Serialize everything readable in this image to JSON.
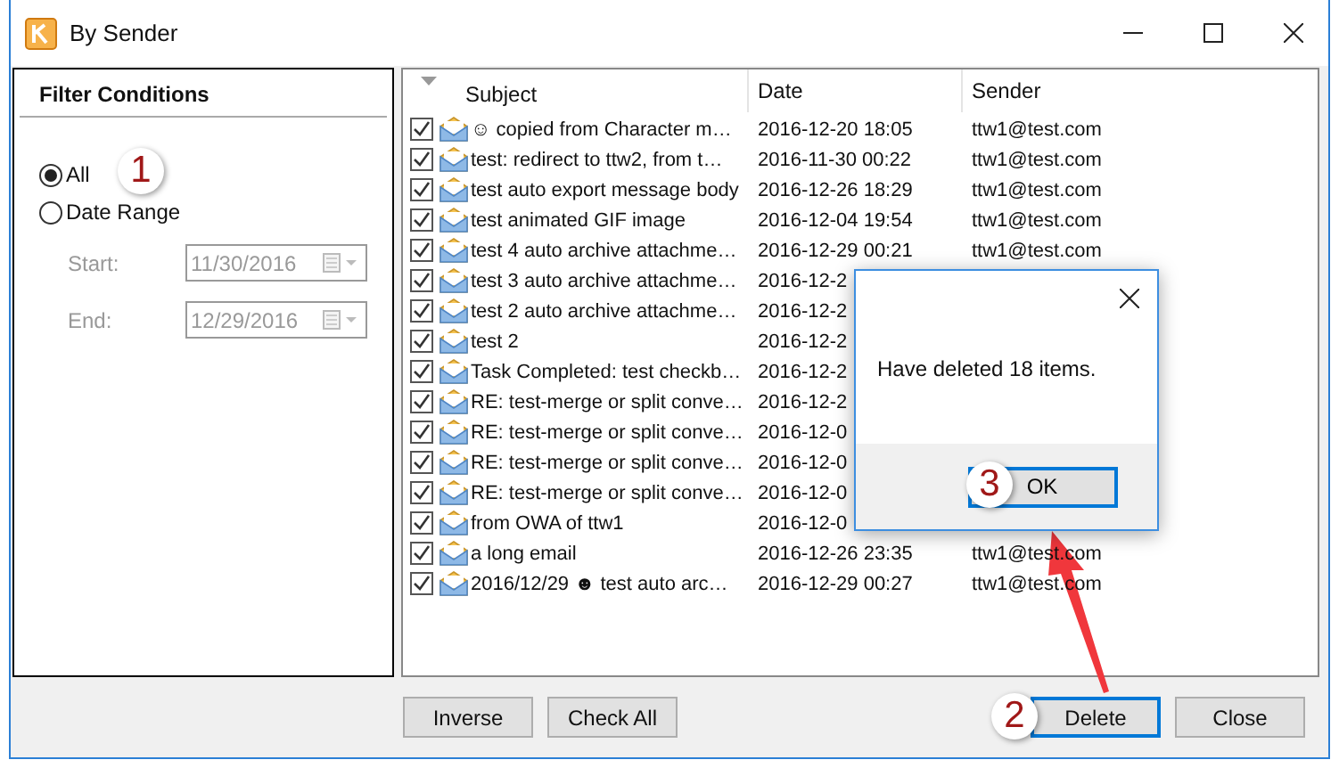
{
  "window": {
    "title": "By Sender"
  },
  "filter": {
    "title": "Filter Conditions",
    "options": [
      {
        "label": "All",
        "selected": true
      },
      {
        "label": "Date Range",
        "selected": false
      }
    ],
    "fields": [
      {
        "label": "Start:",
        "value": "11/30/2016",
        "disabled": true
      },
      {
        "label": "End:",
        "value": "12/29/2016",
        "disabled": true
      }
    ]
  },
  "table": {
    "columns": [
      "Subject",
      "Date",
      "Sender"
    ],
    "rows": [
      {
        "checked": true,
        "subject": "☺ copied from   Character m…",
        "date": "2016-12-20 18:05",
        "sender": "ttw1@test.com"
      },
      {
        "checked": true,
        "subject": "test: redirect to ttw2, from t…",
        "date": "2016-11-30 00:22",
        "sender": "ttw1@test.com"
      },
      {
        "checked": true,
        "subject": "test auto export message body",
        "date": "2016-12-26 18:29",
        "sender": "ttw1@test.com"
      },
      {
        "checked": true,
        "subject": "test animated GIF image",
        "date": "2016-12-04 19:54",
        "sender": "ttw1@test.com"
      },
      {
        "checked": true,
        "subject": "test 4 auto archive attachme…",
        "date": "2016-12-29 00:21",
        "sender": "ttw1@test.com"
      },
      {
        "checked": true,
        "subject": "test 3 auto archive attachme…",
        "date": "2016-12-2"
      },
      {
        "checked": true,
        "subject": "test 2 auto archive attachme…",
        "date": "2016-12-2"
      },
      {
        "checked": true,
        "subject": "test 2",
        "date": "2016-12-2"
      },
      {
        "checked": true,
        "subject": "Task Completed: test checkb…",
        "date": "2016-12-2"
      },
      {
        "checked": true,
        "subject": "RE: test-merge or split conve…",
        "date": "2016-12-2"
      },
      {
        "checked": true,
        "subject": "RE: test-merge or split conve…",
        "date": "2016-12-0"
      },
      {
        "checked": true,
        "subject": "RE: test-merge or split conve…",
        "date": "2016-12-0"
      },
      {
        "checked": true,
        "subject": "RE: test-merge or split conve…",
        "date": "2016-12-0"
      },
      {
        "checked": true,
        "subject": "from OWA of ttw1",
        "date": "2016-12-0"
      },
      {
        "checked": true,
        "subject": "a long email",
        "date": "2016-12-26 23:35",
        "sender": "ttw1@test.com"
      },
      {
        "checked": true,
        "subject": "2016/12/29  ☻ test auto arc…",
        "date": "2016-12-29 00:27",
        "sender": "ttw1@test.com"
      }
    ]
  },
  "buttons": [
    {
      "label": "Inverse",
      "focused": false
    },
    {
      "label": "Check All",
      "focused": false
    },
    {
      "label": "Delete",
      "focused": true
    },
    {
      "label": "Close",
      "focused": false
    }
  ],
  "dialog": {
    "message": "Have deleted 18 items.",
    "button": "OK"
  },
  "step_badges": [
    "1",
    "2",
    "3"
  ]
}
